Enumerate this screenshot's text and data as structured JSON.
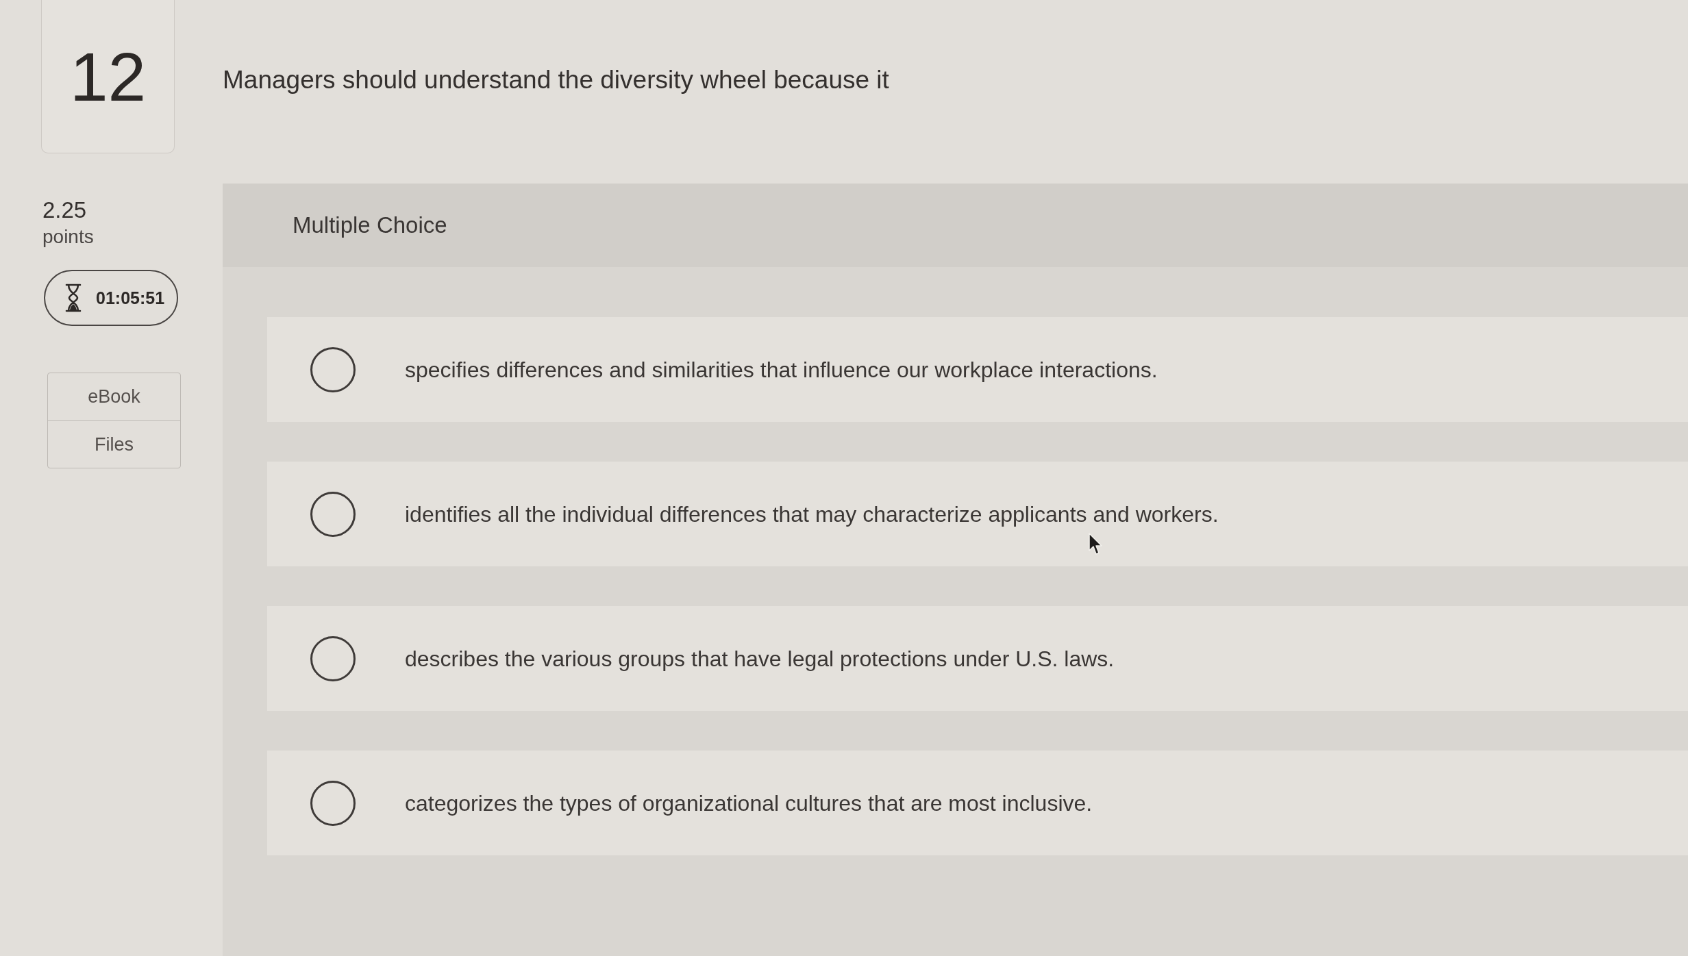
{
  "question": {
    "number": "12",
    "text": "Managers should understand the diversity wheel because it"
  },
  "points": {
    "value": "2.25",
    "label": "points"
  },
  "timer": {
    "time": "01:05:51"
  },
  "resources": [
    {
      "label": "eBook"
    },
    {
      "label": "Files"
    }
  ],
  "panel": {
    "type_label": "Multiple Choice"
  },
  "options": [
    {
      "text": "specifies differences and similarities that influence our workplace interactions.",
      "selected": false
    },
    {
      "text": "identifies all the individual differences that may characterize applicants and workers.",
      "selected": false
    },
    {
      "text": "describes the various groups that have legal protections under U.S. laws.",
      "selected": false
    },
    {
      "text": "categorizes the types of organizational cultures that are most inclusive.",
      "selected": false
    }
  ]
}
